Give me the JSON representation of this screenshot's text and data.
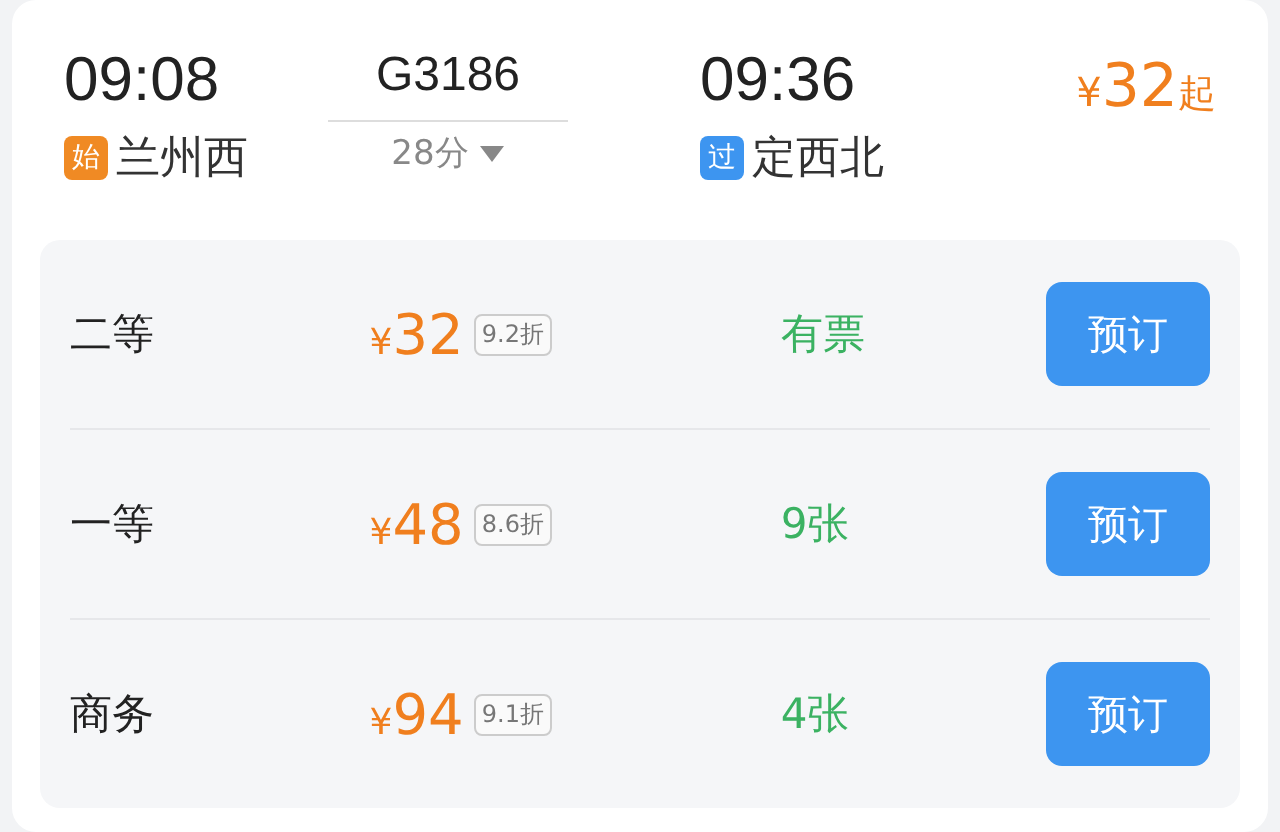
{
  "departure": {
    "time": "09:08",
    "badge": {
      "text": "始",
      "color": "#f08a24"
    },
    "station": "兰州西"
  },
  "train": {
    "number": "G3186",
    "duration": "28分"
  },
  "arrival": {
    "time": "09:36",
    "badge": {
      "text": "过",
      "color": "#3d95f0"
    },
    "station": "定西北"
  },
  "lowest_price": {
    "currency": "¥",
    "amount": "32",
    "suffix": "起"
  },
  "seats": [
    {
      "class": "二等",
      "currency": "¥",
      "price": "32",
      "discount": "9.2折",
      "availability": "有票",
      "button": "预订"
    },
    {
      "class": "一等",
      "currency": "¥",
      "price": "48",
      "discount": "8.6折",
      "availability": "9张",
      "button": "预订"
    },
    {
      "class": "商务",
      "currency": "¥",
      "price": "94",
      "discount": "9.1折",
      "availability": "4张",
      "button": "预订"
    }
  ]
}
